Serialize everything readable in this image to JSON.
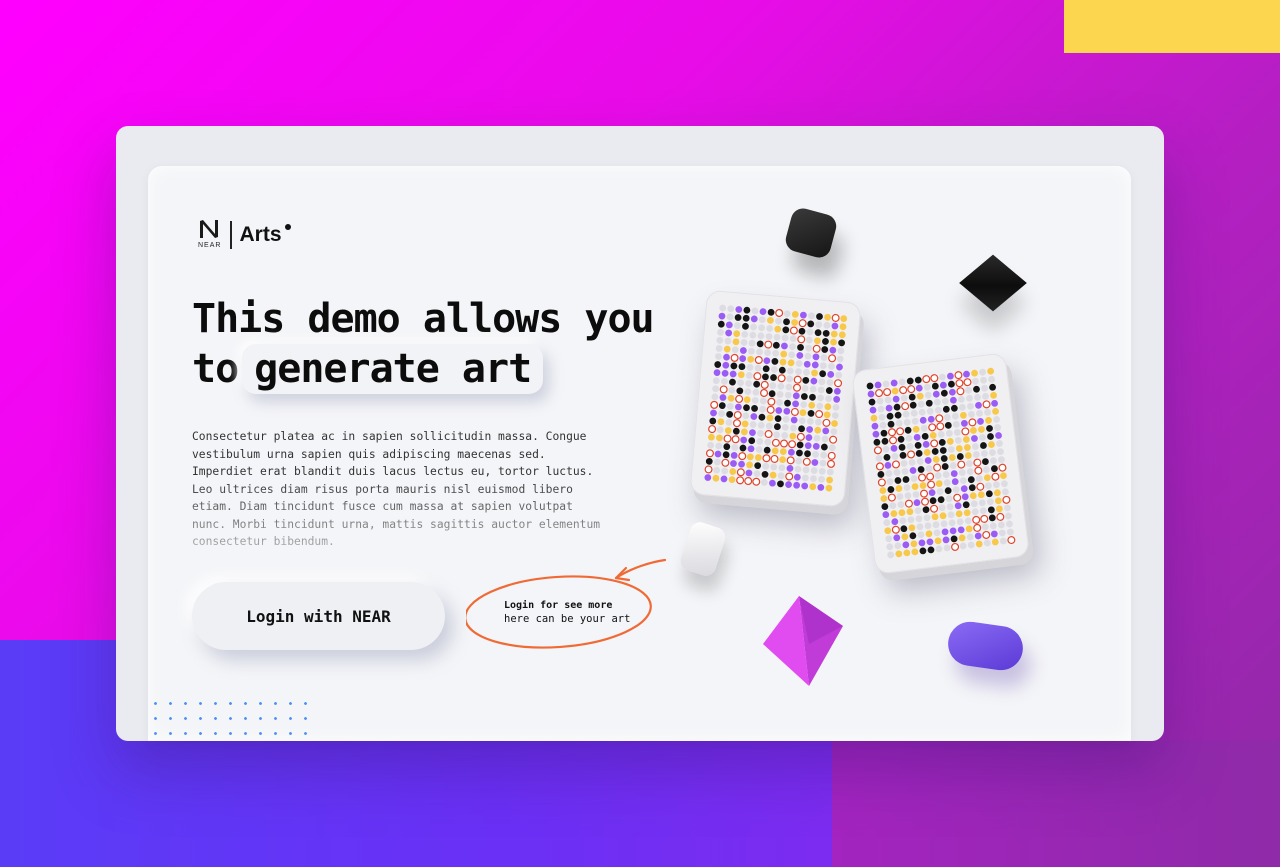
{
  "logo": {
    "brand_small": "NEAR",
    "product": "Arts"
  },
  "hero": {
    "headline_part1": "This demo allows you",
    "headline_part2_prefix": "to",
    "headline_highlight": "generate art",
    "body": "Consectetur platea ac in sapien sollicitudin massa. Congue vestibulum urna sapien quis adipiscing maecenas sed. Imperdiet erat blandit duis lacus lectus eu, tortor luctus. Leo ultrices diam risus porta mauris nisl euismod libero etiam. Diam tincidunt fusce cum massa at sapien volutpat nunc. Morbi tincidunt urna, mattis sagittis auctor elementum consectetur bibendum."
  },
  "cta": {
    "login_label": "Login with NEAR"
  },
  "annotation": {
    "line1": "Login for see more",
    "line2": "here can be your art"
  },
  "colors": {
    "background_magenta": "#ff00ff",
    "background_blue": "#5a3cf7",
    "accent_yellow": "#fcd64f",
    "annotation_orange": "#f06a35",
    "pixel_purple": "#9b5cf5",
    "pixel_yellow": "#f7c84a",
    "pixel_black": "#151515",
    "pixel_red_ring": "#e0432a"
  },
  "icons": {
    "logo_mark": "near-logo-icon",
    "annotation_arrow": "curved-arrow-icon"
  }
}
